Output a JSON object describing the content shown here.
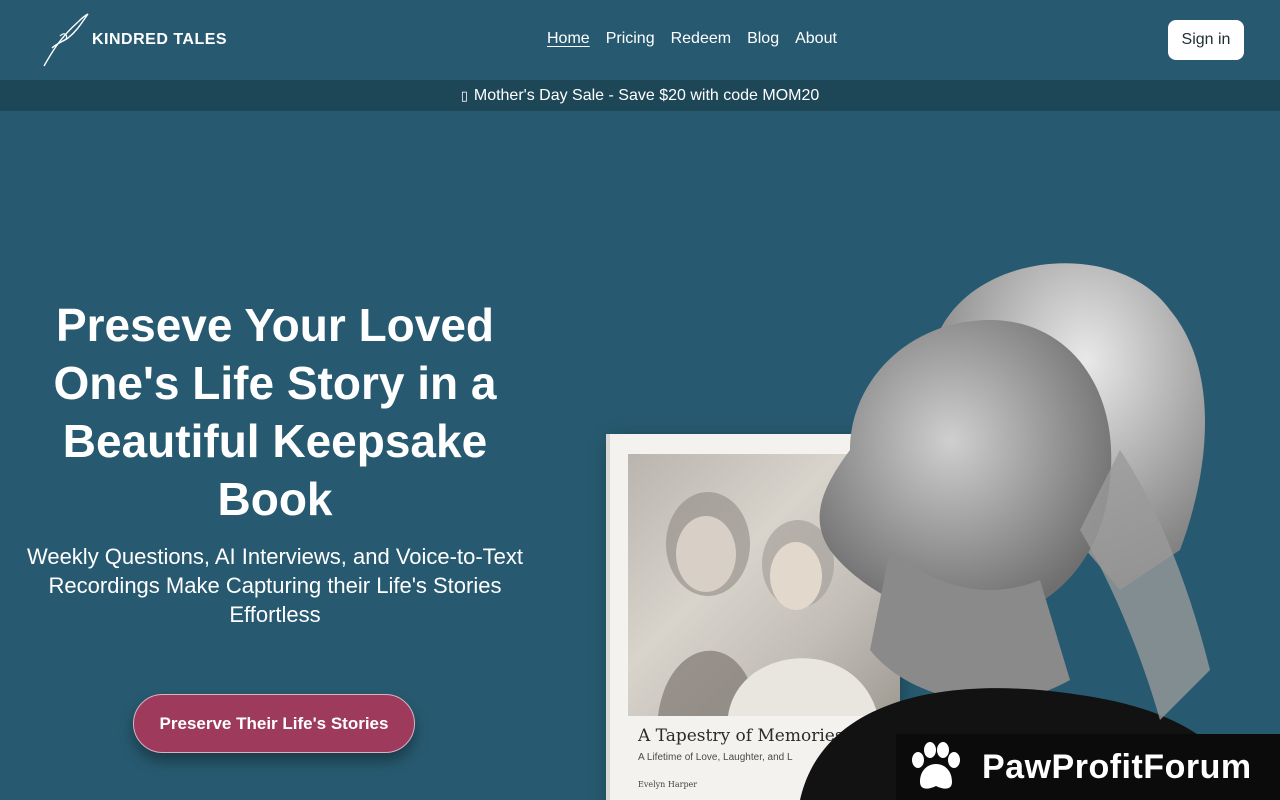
{
  "brand": {
    "name": "KINDRED TALES",
    "logo_icon": "quill-icon"
  },
  "nav": {
    "items": [
      {
        "label": "Home",
        "active": true
      },
      {
        "label": "Pricing",
        "active": false
      },
      {
        "label": "Redeem",
        "active": false
      },
      {
        "label": "Blog",
        "active": false
      },
      {
        "label": "About",
        "active": false
      }
    ],
    "signin_label": "Sign in"
  },
  "promo": {
    "icon": "gift-icon",
    "text": "Mother's Day Sale - Save $20 with code MOM20"
  },
  "hero": {
    "title": "Preseve Your Loved One's Life Story in a Beautiful Keepsake Book",
    "subtitle": "Weekly Questions, AI Interviews, and Voice-to-Text Recordings Make Capturing their Life's Stories Effortless",
    "cta_label": "Preserve Their Life's Stories"
  },
  "book": {
    "title": "A Tapestry of Memories",
    "subtitle": "A Lifetime of Love, Laughter, and L",
    "author": "Evelyn Harper"
  },
  "watermark": {
    "text": "PawProfitForum",
    "icon": "paw-icon"
  },
  "colors": {
    "background": "#275a70",
    "promo_bar": "#1d4657",
    "cta": "#9e3b5d",
    "signin_bg": "#ffffff"
  }
}
